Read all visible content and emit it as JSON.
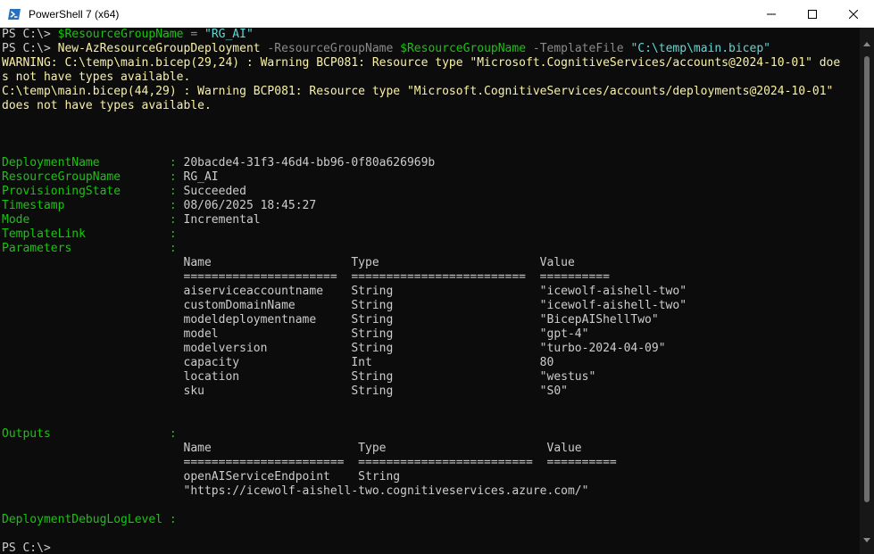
{
  "window": {
    "title": "PowerShell 7 (x64)",
    "icon": "powershell-icon",
    "controls": [
      "minimize-icon",
      "maximize-icon",
      "close-icon"
    ]
  },
  "colors": {
    "background": "#0c0c0c",
    "text": "#cccccc",
    "warning": "#f9f1a5",
    "property": "#16c60c",
    "parameter": "#8a8a8a",
    "string": "#61d6d6",
    "variable": "#3b9dff"
  },
  "console": {
    "cmd1": {
      "prompt": "PS C:\\> ",
      "variable": "$ResourceGroupName",
      "operator": " = ",
      "value": "\"RG_AI\""
    },
    "cmd2": {
      "prompt": "PS C:\\> ",
      "command": "New-AzResourceGroupDeployment",
      "param1": " -ResourceGroupName ",
      "arg1": "$ResourceGroupName",
      "param2": " -TemplateFile ",
      "arg2": "\"C:\\temp\\main.bicep\""
    },
    "warnings": [
      "WARNING: C:\\temp\\main.bicep(29,24) : Warning BCP081: Resource type \"Microsoft.CognitiveServices/accounts@2024-10-01\" doe",
      "s not have types available.",
      "C:\\temp\\main.bicep(44,29) : Warning BCP081: Resource type \"Microsoft.CognitiveServices/accounts/deployments@2024-10-01\"",
      "does not have types available."
    ],
    "properties": [
      {
        "name": "DeploymentName          ",
        "value": "20bacde4-31f3-46d4-bb96-0f80a626969b"
      },
      {
        "name": "ResourceGroupName       ",
        "value": "RG_AI"
      },
      {
        "name": "ProvisioningState       ",
        "value": "Succeeded"
      },
      {
        "name": "Timestamp               ",
        "value": "08/06/2025 18:45:27"
      },
      {
        "name": "Mode                    ",
        "value": "Incremental"
      },
      {
        "name": "TemplateLink            ",
        "value": ""
      },
      {
        "name": "Parameters              ",
        "value": ""
      }
    ],
    "parameters_table": {
      "header": "Name                    Type                       Value",
      "separator": "======================  =========================  ==========",
      "rows": [
        "aiserviceaccountname    String                     \"icewolf-aishell-two\"",
        "customDomainName        String                     \"icewolf-aishell-two\"",
        "modeldeploymentname     String                     \"BicepAIShellTwo\"",
        "model                   String                     \"gpt-4\"",
        "modelversion            String                     \"turbo-2024-04-09\"",
        "capacity                Int                        80",
        "location                String                     \"westus\"",
        "sku                     String                     \"S0\""
      ]
    },
    "outputs": {
      "name": "Outputs                 ",
      "header": "Name                     Type                       Value",
      "separator": "=======================  =========================  ==========",
      "rows": [
        "openAIServiceEndpoint    String",
        "\"https://icewolf-aishell-two.cognitiveservices.azure.com/\""
      ]
    },
    "debug": {
      "name": "DeploymentDebugLogLevel ",
      "value": ""
    },
    "final_prompt": "PS C:\\>"
  }
}
